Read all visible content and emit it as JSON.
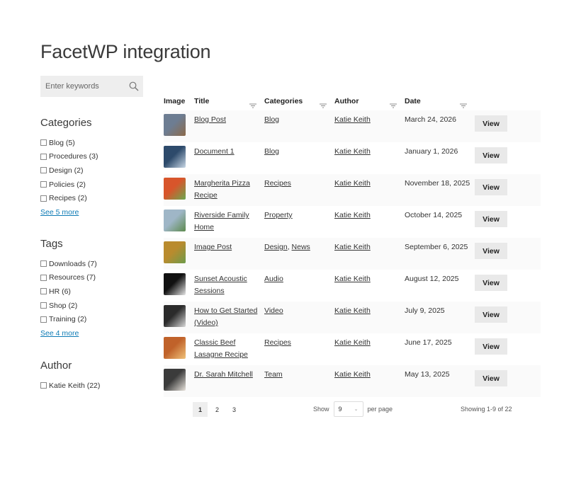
{
  "page_title": "FacetWP integration",
  "search": {
    "placeholder": "Enter keywords"
  },
  "facets": {
    "categories": {
      "title": "Categories",
      "options": [
        "Blog (5)",
        "Procedures (3)",
        "Design (2)",
        "Policies (2)",
        "Recipes (2)"
      ],
      "more": "See 5 more"
    },
    "tags": {
      "title": "Tags",
      "options": [
        "Downloads (7)",
        "Resources (7)",
        "HR (6)",
        "Shop (2)",
        "Training (2)"
      ],
      "more": "See 4 more"
    },
    "author": {
      "title": "Author",
      "options": [
        "Katie Keith (22)"
      ]
    }
  },
  "table": {
    "headers": {
      "image": "Image",
      "title": "Title",
      "categories": "Categories",
      "author": "Author",
      "date": "Date"
    },
    "view_label": "View",
    "rows": [
      {
        "title": "Blog Post",
        "categories": [
          "Blog"
        ],
        "author": "Katie Keith",
        "date": "March 24, 2026",
        "thumb": [
          "#6d7d92",
          "#8c6a4a"
        ]
      },
      {
        "title": "Document 1",
        "categories": [
          "Blog"
        ],
        "author": "Katie Keith",
        "date": "January 1, 2026",
        "thumb": [
          "#2d4a6b",
          "#c9d8e6"
        ]
      },
      {
        "title": "Margherita Pizza Recipe",
        "categories": [
          "Recipes"
        ],
        "author": "Katie Keith",
        "date": "November 18, 2025",
        "thumb": [
          "#d8552b",
          "#6aa84f"
        ]
      },
      {
        "title": "Riverside Family Home",
        "categories": [
          "Property"
        ],
        "author": "Katie Keith",
        "date": "October 14, 2025",
        "thumb": [
          "#9fb6c7",
          "#5d8a4e"
        ]
      },
      {
        "title": "Image Post",
        "categories": [
          "Design",
          "News"
        ],
        "author": "Katie Keith",
        "date": "September 6, 2025",
        "thumb": [
          "#b98b2e",
          "#6d9b4a"
        ]
      },
      {
        "title": "Sunset Acoustic Sessions",
        "categories": [
          "Audio"
        ],
        "author": "Katie Keith",
        "date": "August 12, 2025",
        "thumb": [
          "#111111",
          "#e6e6e6"
        ]
      },
      {
        "title": "How to Get Started (Video)",
        "categories": [
          "Video"
        ],
        "author": "Katie Keith",
        "date": "July 9, 2025",
        "thumb": [
          "#2b2b2b",
          "#d9d9d9"
        ]
      },
      {
        "title": "Classic Beef Lasagne Recipe",
        "categories": [
          "Recipes"
        ],
        "author": "Katie Keith",
        "date": "June 17, 2025",
        "thumb": [
          "#c0622a",
          "#f0c27a"
        ]
      },
      {
        "title": "Dr. Sarah Mitchell",
        "categories": [
          "Team"
        ],
        "author": "Katie Keith",
        "date": "May 13, 2025",
        "thumb": [
          "#3b3b3b",
          "#e8e3dc"
        ]
      }
    ]
  },
  "pagination": {
    "pages": [
      "1",
      "2",
      "3"
    ],
    "active": "1",
    "show_label": "Show",
    "per_page_value": "9",
    "per_page_label": "per page",
    "showing": "Showing 1-9 of 22"
  }
}
